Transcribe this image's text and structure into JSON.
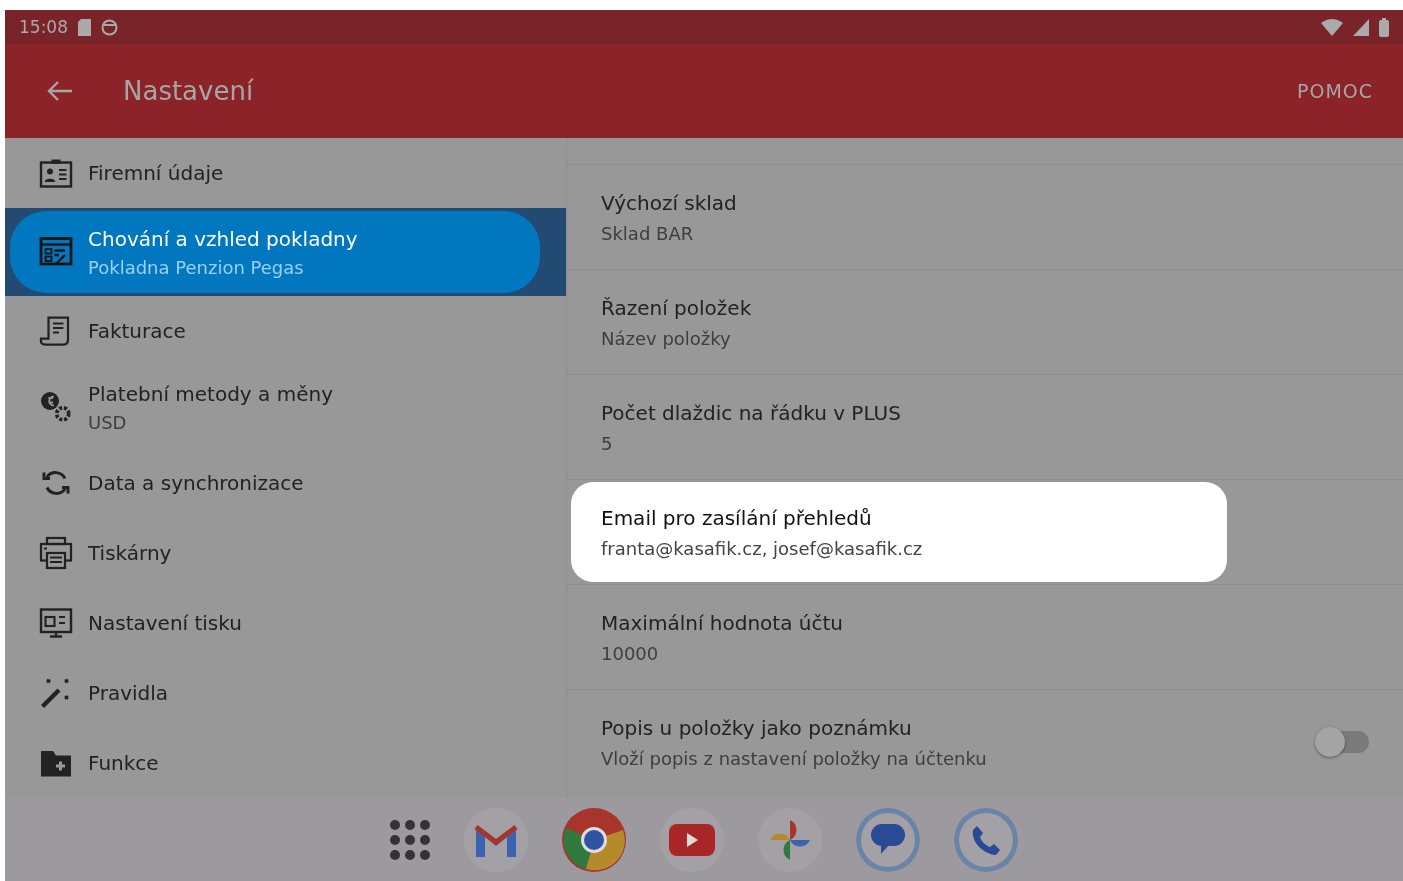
{
  "status_bar": {
    "time": "15:08"
  },
  "app_bar": {
    "title": "Nastavení",
    "action": "POMOC"
  },
  "sidebar": {
    "items": [
      {
        "title": "Firemní údaje",
        "selected": false
      },
      {
        "title": "Chování a vzhled pokladny",
        "subtitle": "Pokladna Penzion Pegas",
        "selected": true
      },
      {
        "title": "Fakturace",
        "selected": false
      },
      {
        "title": "Platební metody a měny",
        "subtitle": "USD",
        "selected": false
      },
      {
        "title": "Data a synchronizace",
        "selected": false
      },
      {
        "title": "Tiskárny",
        "selected": false
      },
      {
        "title": "Nastavení tisku",
        "selected": false
      },
      {
        "title": "Pravidla",
        "selected": false
      },
      {
        "title": "Funkce",
        "selected": false
      }
    ]
  },
  "settings": [
    {
      "kind": "value",
      "title": "Výchozí sklad",
      "value": "Sklad BAR",
      "highlighted": false
    },
    {
      "kind": "value",
      "title": "Řazení položek",
      "value": "Název položky",
      "highlighted": false
    },
    {
      "kind": "value",
      "title": "Počet dlaždic na řádku v PLUS",
      "value": "5",
      "highlighted": false
    },
    {
      "kind": "value",
      "title": "Email pro zasílání přehledů",
      "value": "franta@kasafik.cz, josef@kasafik.cz",
      "highlighted": true
    },
    {
      "kind": "value",
      "title": "Maximální hodnota účtu",
      "value": "10000",
      "highlighted": false
    },
    {
      "kind": "toggle",
      "title": "Popis u položky jako poznámku",
      "value": "Vloží popis z nastavení položky na účtenku",
      "on": false,
      "highlighted": false
    }
  ]
}
